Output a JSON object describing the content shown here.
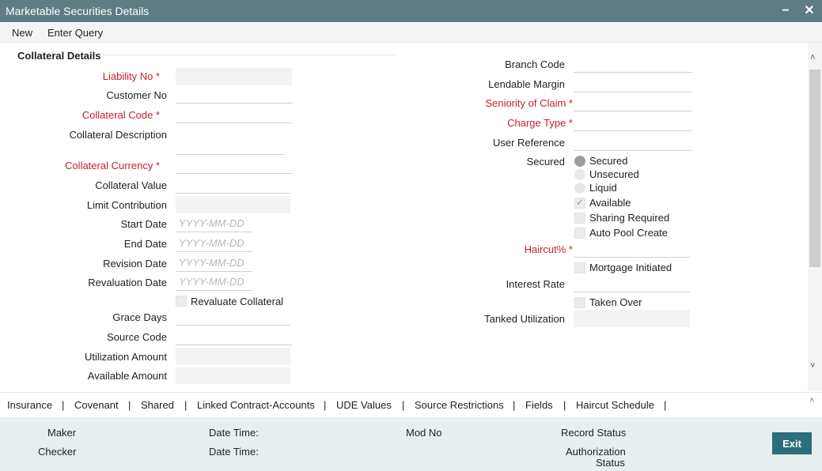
{
  "window": {
    "title": "Marketable Securities Details",
    "minimize_glyph": "−",
    "close_glyph": "✕"
  },
  "menu": {
    "new": "New",
    "enter_query": "Enter Query"
  },
  "section": {
    "title": "Collateral Details"
  },
  "left": {
    "liability_no": "Liability No *",
    "customer_no": "Customer No",
    "collateral_code": "Collateral Code *",
    "collateral_description": "Collateral Description",
    "collateral_currency": "Collateral Currency *",
    "collateral_value": "Collateral Value",
    "limit_contribution": "Limit Contribution",
    "start_date": "Start Date",
    "end_date": "End Date",
    "revision_date": "Revision Date",
    "revaluation_date": "Revaluation Date",
    "date_placeholder": "YYYY-MM-DD",
    "revaluate_collateral": "Revaluate Collateral",
    "grace_days": "Grace Days",
    "source_code": "Source Code",
    "utilization_amount": "Utilization Amount",
    "available_amount": "Available Amount"
  },
  "right": {
    "branch_code": "Branch Code",
    "lendable_margin": "Lendable Margin",
    "seniority_of_claim": "Seniority of Claim *",
    "charge_type": "Charge Type *",
    "user_reference": "User Reference",
    "secured_label": "Secured",
    "secured_options": [
      "Secured",
      "Unsecured",
      "Liquid"
    ],
    "secured_selected": "Secured",
    "available": "Available",
    "available_checked": true,
    "sharing_required": "Sharing Required",
    "auto_pool_create": "Auto Pool Create",
    "haircut": "Haircut% *",
    "mortgage_initiated": "Mortgage Initiated",
    "interest_rate": "Interest Rate",
    "taken_over": "Taken Over",
    "tanked_utilization": "Tanked Utilization"
  },
  "tabs": [
    "Insurance",
    "Covenant",
    "Shared",
    "Linked Contract-Accounts",
    "UDE Values",
    "Source Restrictions",
    "Fields",
    "Haircut Schedule"
  ],
  "footer": {
    "maker": "Maker",
    "checker": "Checker",
    "date_time_1": "Date Time:",
    "date_time_2": "Date Time:",
    "mod_no": "Mod No",
    "record_status": "Record Status",
    "authorization_status_1": "Authorization",
    "authorization_status_2": "Status",
    "exit": "Exit"
  },
  "colors": {
    "titlebar": "#5e7d83",
    "required": "#c8202a",
    "exit_button": "#2c6f7c",
    "footer_bg": "#e8eff0"
  }
}
